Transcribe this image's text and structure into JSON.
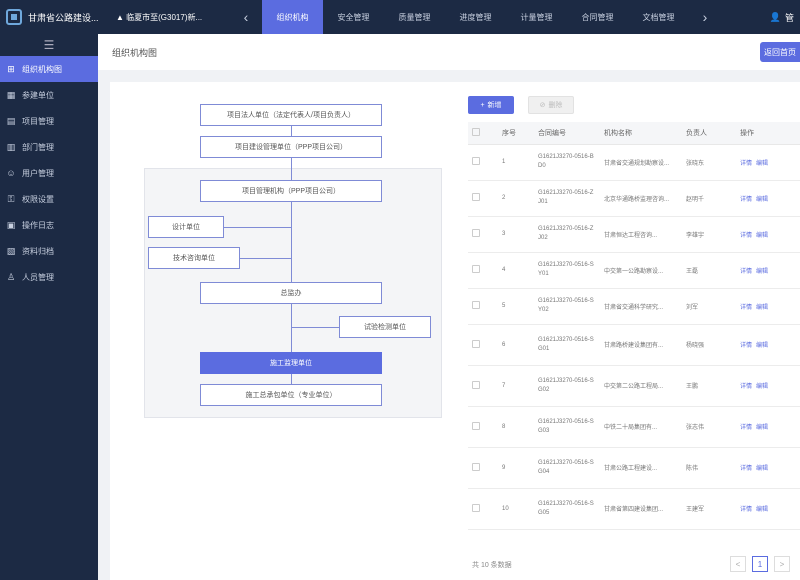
{
  "app": {
    "brand_name": "甘肃省公路建设...",
    "project_selector": "▲ 临夏市至(G3017)新...",
    "user_label": "管"
  },
  "top_tabs": [
    "组织机构",
    "安全管理",
    "质量管理",
    "进度管理",
    "计量管理",
    "合同管理",
    "文档管理"
  ],
  "active_tab_index": 0,
  "sidebar": {
    "items": [
      {
        "icon": "org-icon",
        "label": "组织机构图"
      },
      {
        "icon": "building-icon",
        "label": "参建单位"
      },
      {
        "icon": "project-icon",
        "label": "项目管理"
      },
      {
        "icon": "dept-icon",
        "label": "部门管理"
      },
      {
        "icon": "user-icon",
        "label": "用户管理"
      },
      {
        "icon": "key-icon",
        "label": "权限设置"
      },
      {
        "icon": "log-icon",
        "label": "操作日志"
      },
      {
        "icon": "doc-icon",
        "label": "资料归档"
      },
      {
        "icon": "person-icon",
        "label": "人员管理"
      }
    ],
    "active_index": 0
  },
  "page": {
    "title": "组织机构图",
    "header_button": "返回首页"
  },
  "diagram": {
    "nodes": [
      "项目法人单位（法定代表人/项目负责人）",
      "项目建设管理单位（PPP项目公司）",
      "项目管理机构（PPP项目公司）",
      "设计单位",
      "技术咨询单位",
      "总监办",
      "试验检测单位",
      "施工监理单位",
      "施工总承包单位（专业单位）"
    ]
  },
  "toolbar": {
    "add_label": "新增",
    "delete_label": "删除"
  },
  "table": {
    "columns": [
      "",
      "序号",
      "合同编号",
      "机构名称",
      "负责人",
      "操作"
    ],
    "rows": [
      {
        "no": "1",
        "code": "G1621J3270-0516-BD0",
        "name": "甘肃省交通规划勘察设...",
        "person": "张晓东"
      },
      {
        "no": "2",
        "code": "G1621J3270-0516-ZJ01",
        "name": "北京华通路桥监理咨询...",
        "person": "赵明千"
      },
      {
        "no": "3",
        "code": "G1621J3270-0516-ZJ02",
        "name": "甘肃恒达工程咨询...",
        "person": "李雄宇"
      },
      {
        "no": "4",
        "code": "G1621J3270-0516-SY01",
        "name": "中交第一公路勘察设...",
        "person": "王磊"
      },
      {
        "no": "5",
        "code": "G1621J3270-0516-SY02",
        "name": "甘肃省交通科学研究...",
        "person": "刘军"
      },
      {
        "no": "6",
        "code": "G1621J3270-0516-SG01",
        "name": "甘肃路桥建设集团有...",
        "person": "杨晓强"
      },
      {
        "no": "7",
        "code": "G1621J3270-0516-SG02",
        "name": "中交第二公路工程局...",
        "person": "王鹏"
      },
      {
        "no": "8",
        "code": "G1621J3270-0516-SG03",
        "name": "中铁二十局集团有...",
        "person": "张志伟"
      },
      {
        "no": "9",
        "code": "G1621J3270-0516-SG04",
        "name": "甘肃公路工程建设...",
        "person": "陈伟"
      },
      {
        "no": "10",
        "code": "G1621J3270-0516-SG05",
        "name": "甘肃省第四建设集团...",
        "person": "王建军"
      }
    ],
    "op_view": "详情",
    "op_edit": "编辑"
  },
  "pagination": {
    "total_text": "共 10 条数据",
    "prev": "<",
    "current": "1",
    "next": ">"
  },
  "colors": {
    "accent": "#5b6ce0",
    "nav_bg": "#1c2a44"
  }
}
